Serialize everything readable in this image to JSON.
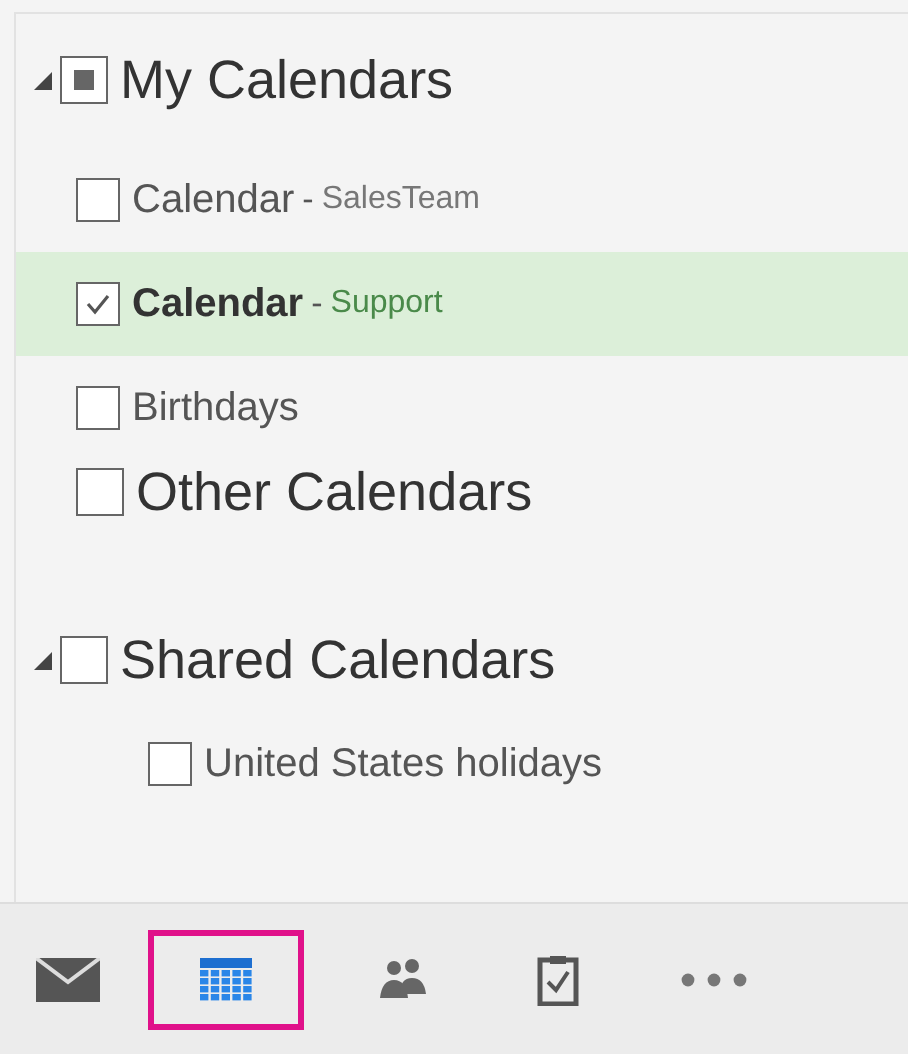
{
  "groups": [
    {
      "name": "My Calendars",
      "expanded": true,
      "partial": true,
      "items": [
        {
          "name": "Calendar",
          "separator": "-",
          "suffix": "SalesTeam",
          "checked": false,
          "selected": false
        },
        {
          "name": "Calendar",
          "separator": "-",
          "suffix": "Support",
          "checked": true,
          "selected": true
        },
        {
          "name": "Birthdays",
          "checked": false,
          "selected": false
        }
      ]
    },
    {
      "name": "Other Calendars",
      "checked": false
    },
    {
      "name": "Shared Calendars",
      "expanded": true,
      "checked": false,
      "items": [
        {
          "name": "United States holidays",
          "checked": false,
          "selected": false
        }
      ]
    }
  ],
  "nav": [
    {
      "kind": "mail",
      "selected": false
    },
    {
      "kind": "calendar",
      "selected": true
    },
    {
      "kind": "people",
      "selected": false
    },
    {
      "kind": "tasks",
      "selected": false
    },
    {
      "kind": "more",
      "selected": false
    }
  ]
}
